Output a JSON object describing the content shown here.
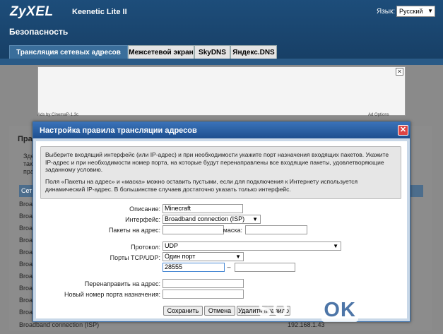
{
  "header": {
    "logo": "ZyXEL",
    "model": "Keenetic Lite II",
    "language_label": "Язык:",
    "language_value": "Русский",
    "section_title": "Безопасность"
  },
  "tabs": [
    {
      "label": "Трансляция сетевых адресов (NAT)",
      "active": true
    },
    {
      "label": "Межсетевой экран",
      "active": false
    },
    {
      "label": "SkyDNS",
      "active": false
    },
    {
      "label": "Яндекс.DNS",
      "active": false
    }
  ],
  "ad": {
    "left_text": "Ads by CinemaP-1.3c",
    "right_text": "Ad Options"
  },
  "background": {
    "panel_title_fragment": "Пра",
    "text_fragments": [
      "Зде",
      "так",
      "пра"
    ],
    "col_fragment": "Сет",
    "row_prefix": "Broa",
    "last_row": "Broadband connection (ISP)",
    "last_row_ip": "192.168.1.43"
  },
  "dialog": {
    "title": "Настройка правила трансляции адресов",
    "info_1": "Выберите входящий интерфейс (или IP-адрес) и при необходимости укажите порт назначения входящих пакетов. Укажите IP-адрес и при необходимости номер порта, на которые будут перенаправлены все входящие пакеты, удовлетворяющие заданному условию.",
    "info_2": "Поля «Пакеты на адрес» и «маска» можно оставить пустыми, если для подключения к Интернету используется динамический IP-адрес. В большинстве случаев достаточно указать только интерфейс.",
    "fields": {
      "description_label": "Описание:",
      "description_value": "Minecraft",
      "interface_label": "Интерфейс:",
      "interface_value": "Broadband connection (ISP)",
      "packets_label": "Пакеты на адрес:",
      "packets_value": "",
      "mask_label": "маска:",
      "mask_value": "",
      "protocol_label": "Протокол:",
      "protocol_value": "UDP",
      "ports_label": "Порты TCP/UDP:",
      "ports_value": "Один порт",
      "port_from": "28555",
      "port_dash": "–",
      "port_to": "",
      "redirect_label": "Перенаправить на адрес:",
      "redirect_value": "",
      "new_port_label": "Новый номер порта назначения:",
      "new_port_value": ""
    },
    "buttons": {
      "save": "Сохранить",
      "cancel": "Отмена",
      "delete": "Удалить правило"
    }
  },
  "watermark": {
    "part1": "SOFT-",
    "part2": "OK",
    "part3": ".NET"
  }
}
